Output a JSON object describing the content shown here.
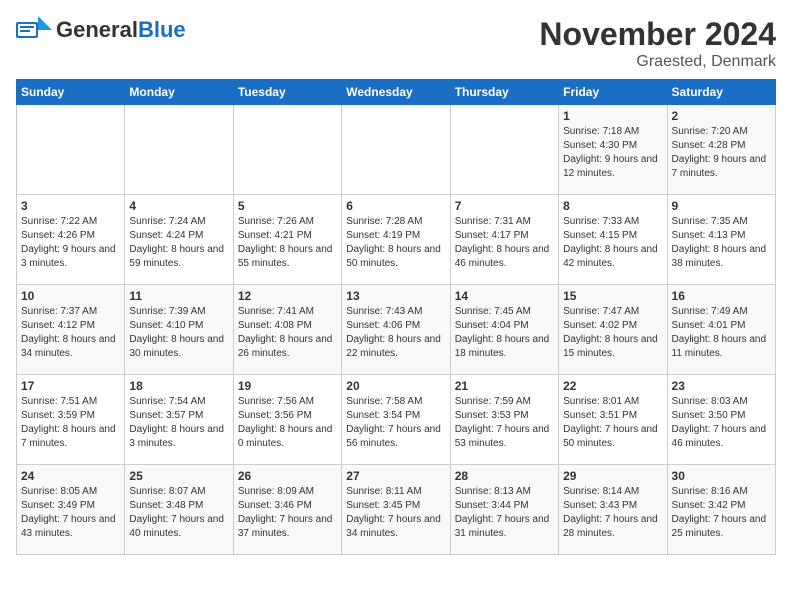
{
  "header": {
    "logo_general": "General",
    "logo_blue": "Blue",
    "month": "November 2024",
    "location": "Graested, Denmark"
  },
  "weekdays": [
    "Sunday",
    "Monday",
    "Tuesday",
    "Wednesday",
    "Thursday",
    "Friday",
    "Saturday"
  ],
  "weeks": [
    [
      {
        "day": "",
        "sunrise": "",
        "sunset": "",
        "daylight": ""
      },
      {
        "day": "",
        "sunrise": "",
        "sunset": "",
        "daylight": ""
      },
      {
        "day": "",
        "sunrise": "",
        "sunset": "",
        "daylight": ""
      },
      {
        "day": "",
        "sunrise": "",
        "sunset": "",
        "daylight": ""
      },
      {
        "day": "",
        "sunrise": "",
        "sunset": "",
        "daylight": ""
      },
      {
        "day": "1",
        "sunrise": "Sunrise: 7:18 AM",
        "sunset": "Sunset: 4:30 PM",
        "daylight": "Daylight: 9 hours and 12 minutes."
      },
      {
        "day": "2",
        "sunrise": "Sunrise: 7:20 AM",
        "sunset": "Sunset: 4:28 PM",
        "daylight": "Daylight: 9 hours and 7 minutes."
      }
    ],
    [
      {
        "day": "3",
        "sunrise": "Sunrise: 7:22 AM",
        "sunset": "Sunset: 4:26 PM",
        "daylight": "Daylight: 9 hours and 3 minutes."
      },
      {
        "day": "4",
        "sunrise": "Sunrise: 7:24 AM",
        "sunset": "Sunset: 4:24 PM",
        "daylight": "Daylight: 8 hours and 59 minutes."
      },
      {
        "day": "5",
        "sunrise": "Sunrise: 7:26 AM",
        "sunset": "Sunset: 4:21 PM",
        "daylight": "Daylight: 8 hours and 55 minutes."
      },
      {
        "day": "6",
        "sunrise": "Sunrise: 7:28 AM",
        "sunset": "Sunset: 4:19 PM",
        "daylight": "Daylight: 8 hours and 50 minutes."
      },
      {
        "day": "7",
        "sunrise": "Sunrise: 7:31 AM",
        "sunset": "Sunset: 4:17 PM",
        "daylight": "Daylight: 8 hours and 46 minutes."
      },
      {
        "day": "8",
        "sunrise": "Sunrise: 7:33 AM",
        "sunset": "Sunset: 4:15 PM",
        "daylight": "Daylight: 8 hours and 42 minutes."
      },
      {
        "day": "9",
        "sunrise": "Sunrise: 7:35 AM",
        "sunset": "Sunset: 4:13 PM",
        "daylight": "Daylight: 8 hours and 38 minutes."
      }
    ],
    [
      {
        "day": "10",
        "sunrise": "Sunrise: 7:37 AM",
        "sunset": "Sunset: 4:12 PM",
        "daylight": "Daylight: 8 hours and 34 minutes."
      },
      {
        "day": "11",
        "sunrise": "Sunrise: 7:39 AM",
        "sunset": "Sunset: 4:10 PM",
        "daylight": "Daylight: 8 hours and 30 minutes."
      },
      {
        "day": "12",
        "sunrise": "Sunrise: 7:41 AM",
        "sunset": "Sunset: 4:08 PM",
        "daylight": "Daylight: 8 hours and 26 minutes."
      },
      {
        "day": "13",
        "sunrise": "Sunrise: 7:43 AM",
        "sunset": "Sunset: 4:06 PM",
        "daylight": "Daylight: 8 hours and 22 minutes."
      },
      {
        "day": "14",
        "sunrise": "Sunrise: 7:45 AM",
        "sunset": "Sunset: 4:04 PM",
        "daylight": "Daylight: 8 hours and 18 minutes."
      },
      {
        "day": "15",
        "sunrise": "Sunrise: 7:47 AM",
        "sunset": "Sunset: 4:02 PM",
        "daylight": "Daylight: 8 hours and 15 minutes."
      },
      {
        "day": "16",
        "sunrise": "Sunrise: 7:49 AM",
        "sunset": "Sunset: 4:01 PM",
        "daylight": "Daylight: 8 hours and 11 minutes."
      }
    ],
    [
      {
        "day": "17",
        "sunrise": "Sunrise: 7:51 AM",
        "sunset": "Sunset: 3:59 PM",
        "daylight": "Daylight: 8 hours and 7 minutes."
      },
      {
        "day": "18",
        "sunrise": "Sunrise: 7:54 AM",
        "sunset": "Sunset: 3:57 PM",
        "daylight": "Daylight: 8 hours and 3 minutes."
      },
      {
        "day": "19",
        "sunrise": "Sunrise: 7:56 AM",
        "sunset": "Sunset: 3:56 PM",
        "daylight": "Daylight: 8 hours and 0 minutes."
      },
      {
        "day": "20",
        "sunrise": "Sunrise: 7:58 AM",
        "sunset": "Sunset: 3:54 PM",
        "daylight": "Daylight: 7 hours and 56 minutes."
      },
      {
        "day": "21",
        "sunrise": "Sunrise: 7:59 AM",
        "sunset": "Sunset: 3:53 PM",
        "daylight": "Daylight: 7 hours and 53 minutes."
      },
      {
        "day": "22",
        "sunrise": "Sunrise: 8:01 AM",
        "sunset": "Sunset: 3:51 PM",
        "daylight": "Daylight: 7 hours and 50 minutes."
      },
      {
        "day": "23",
        "sunrise": "Sunrise: 8:03 AM",
        "sunset": "Sunset: 3:50 PM",
        "daylight": "Daylight: 7 hours and 46 minutes."
      }
    ],
    [
      {
        "day": "24",
        "sunrise": "Sunrise: 8:05 AM",
        "sunset": "Sunset: 3:49 PM",
        "daylight": "Daylight: 7 hours and 43 minutes."
      },
      {
        "day": "25",
        "sunrise": "Sunrise: 8:07 AM",
        "sunset": "Sunset: 3:48 PM",
        "daylight": "Daylight: 7 hours and 40 minutes."
      },
      {
        "day": "26",
        "sunrise": "Sunrise: 8:09 AM",
        "sunset": "Sunset: 3:46 PM",
        "daylight": "Daylight: 7 hours and 37 minutes."
      },
      {
        "day": "27",
        "sunrise": "Sunrise: 8:11 AM",
        "sunset": "Sunset: 3:45 PM",
        "daylight": "Daylight: 7 hours and 34 minutes."
      },
      {
        "day": "28",
        "sunrise": "Sunrise: 8:13 AM",
        "sunset": "Sunset: 3:44 PM",
        "daylight": "Daylight: 7 hours and 31 minutes."
      },
      {
        "day": "29",
        "sunrise": "Sunrise: 8:14 AM",
        "sunset": "Sunset: 3:43 PM",
        "daylight": "Daylight: 7 hours and 28 minutes."
      },
      {
        "day": "30",
        "sunrise": "Sunrise: 8:16 AM",
        "sunset": "Sunset: 3:42 PM",
        "daylight": "Daylight: 7 hours and 25 minutes."
      }
    ]
  ]
}
